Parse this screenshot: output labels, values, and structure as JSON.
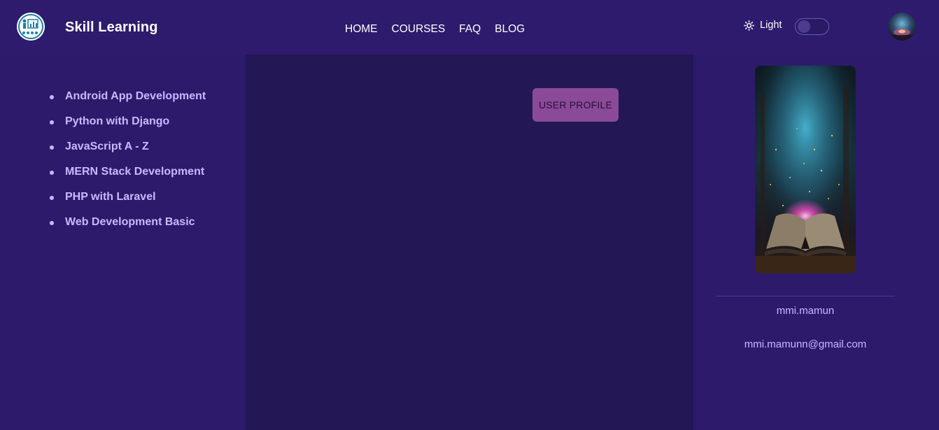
{
  "header": {
    "brand": "Skill Learning",
    "logo_icon": "skill-learning-logo",
    "nav": [
      "HOME",
      "COURSES",
      "FAQ",
      "BLOG"
    ],
    "theme_label": "Light",
    "theme_icon": "sun-icon",
    "theme_toggle_on": false
  },
  "sidebar": {
    "courses": [
      "Android App Development",
      "Python with Django",
      "JavaScript A - Z",
      "MERN Stack Development",
      "PHP with Laravel",
      "Web Development Basic"
    ]
  },
  "main": {
    "profile_button": "USER PROFILE"
  },
  "profile": {
    "username": "mmi.mamun",
    "email": "mmi.mamunn@gmail.com"
  },
  "colors": {
    "background": "#2d1a6b",
    "main_background": "#231755",
    "accent_button": "#8a4a97",
    "link_text": "#c9b8ff"
  }
}
